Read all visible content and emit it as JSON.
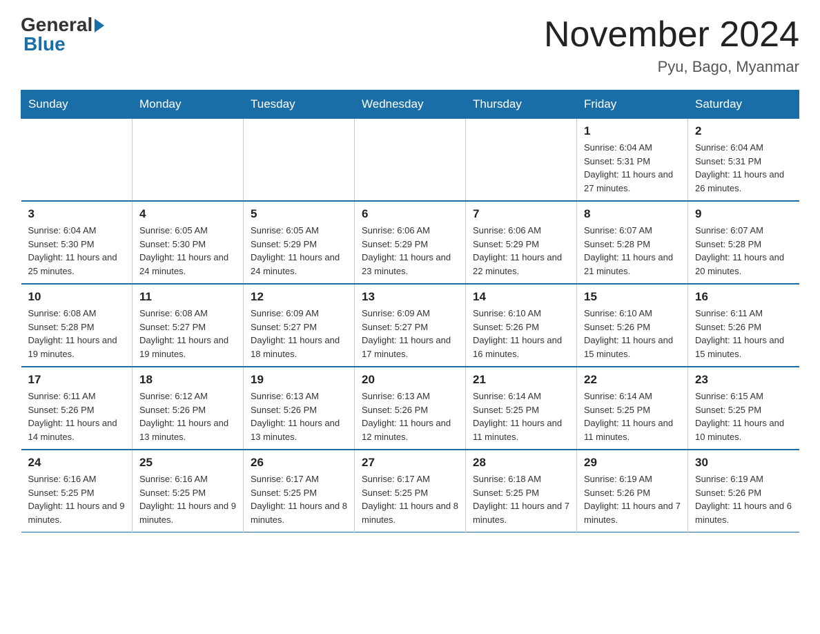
{
  "logo": {
    "general": "General",
    "blue": "Blue"
  },
  "header": {
    "month_year": "November 2024",
    "location": "Pyu, Bago, Myanmar"
  },
  "weekdays": [
    "Sunday",
    "Monday",
    "Tuesday",
    "Wednesday",
    "Thursday",
    "Friday",
    "Saturday"
  ],
  "weeks": [
    [
      {
        "day": "",
        "info": ""
      },
      {
        "day": "",
        "info": ""
      },
      {
        "day": "",
        "info": ""
      },
      {
        "day": "",
        "info": ""
      },
      {
        "day": "",
        "info": ""
      },
      {
        "day": "1",
        "info": "Sunrise: 6:04 AM\nSunset: 5:31 PM\nDaylight: 11 hours and 27 minutes."
      },
      {
        "day": "2",
        "info": "Sunrise: 6:04 AM\nSunset: 5:31 PM\nDaylight: 11 hours and 26 minutes."
      }
    ],
    [
      {
        "day": "3",
        "info": "Sunrise: 6:04 AM\nSunset: 5:30 PM\nDaylight: 11 hours and 25 minutes."
      },
      {
        "day": "4",
        "info": "Sunrise: 6:05 AM\nSunset: 5:30 PM\nDaylight: 11 hours and 24 minutes."
      },
      {
        "day": "5",
        "info": "Sunrise: 6:05 AM\nSunset: 5:29 PM\nDaylight: 11 hours and 24 minutes."
      },
      {
        "day": "6",
        "info": "Sunrise: 6:06 AM\nSunset: 5:29 PM\nDaylight: 11 hours and 23 minutes."
      },
      {
        "day": "7",
        "info": "Sunrise: 6:06 AM\nSunset: 5:29 PM\nDaylight: 11 hours and 22 minutes."
      },
      {
        "day": "8",
        "info": "Sunrise: 6:07 AM\nSunset: 5:28 PM\nDaylight: 11 hours and 21 minutes."
      },
      {
        "day": "9",
        "info": "Sunrise: 6:07 AM\nSunset: 5:28 PM\nDaylight: 11 hours and 20 minutes."
      }
    ],
    [
      {
        "day": "10",
        "info": "Sunrise: 6:08 AM\nSunset: 5:28 PM\nDaylight: 11 hours and 19 minutes."
      },
      {
        "day": "11",
        "info": "Sunrise: 6:08 AM\nSunset: 5:27 PM\nDaylight: 11 hours and 19 minutes."
      },
      {
        "day": "12",
        "info": "Sunrise: 6:09 AM\nSunset: 5:27 PM\nDaylight: 11 hours and 18 minutes."
      },
      {
        "day": "13",
        "info": "Sunrise: 6:09 AM\nSunset: 5:27 PM\nDaylight: 11 hours and 17 minutes."
      },
      {
        "day": "14",
        "info": "Sunrise: 6:10 AM\nSunset: 5:26 PM\nDaylight: 11 hours and 16 minutes."
      },
      {
        "day": "15",
        "info": "Sunrise: 6:10 AM\nSunset: 5:26 PM\nDaylight: 11 hours and 15 minutes."
      },
      {
        "day": "16",
        "info": "Sunrise: 6:11 AM\nSunset: 5:26 PM\nDaylight: 11 hours and 15 minutes."
      }
    ],
    [
      {
        "day": "17",
        "info": "Sunrise: 6:11 AM\nSunset: 5:26 PM\nDaylight: 11 hours and 14 minutes."
      },
      {
        "day": "18",
        "info": "Sunrise: 6:12 AM\nSunset: 5:26 PM\nDaylight: 11 hours and 13 minutes."
      },
      {
        "day": "19",
        "info": "Sunrise: 6:13 AM\nSunset: 5:26 PM\nDaylight: 11 hours and 13 minutes."
      },
      {
        "day": "20",
        "info": "Sunrise: 6:13 AM\nSunset: 5:26 PM\nDaylight: 11 hours and 12 minutes."
      },
      {
        "day": "21",
        "info": "Sunrise: 6:14 AM\nSunset: 5:25 PM\nDaylight: 11 hours and 11 minutes."
      },
      {
        "day": "22",
        "info": "Sunrise: 6:14 AM\nSunset: 5:25 PM\nDaylight: 11 hours and 11 minutes."
      },
      {
        "day": "23",
        "info": "Sunrise: 6:15 AM\nSunset: 5:25 PM\nDaylight: 11 hours and 10 minutes."
      }
    ],
    [
      {
        "day": "24",
        "info": "Sunrise: 6:16 AM\nSunset: 5:25 PM\nDaylight: 11 hours and 9 minutes."
      },
      {
        "day": "25",
        "info": "Sunrise: 6:16 AM\nSunset: 5:25 PM\nDaylight: 11 hours and 9 minutes."
      },
      {
        "day": "26",
        "info": "Sunrise: 6:17 AM\nSunset: 5:25 PM\nDaylight: 11 hours and 8 minutes."
      },
      {
        "day": "27",
        "info": "Sunrise: 6:17 AM\nSunset: 5:25 PM\nDaylight: 11 hours and 8 minutes."
      },
      {
        "day": "28",
        "info": "Sunrise: 6:18 AM\nSunset: 5:25 PM\nDaylight: 11 hours and 7 minutes."
      },
      {
        "day": "29",
        "info": "Sunrise: 6:19 AM\nSunset: 5:26 PM\nDaylight: 11 hours and 7 minutes."
      },
      {
        "day": "30",
        "info": "Sunrise: 6:19 AM\nSunset: 5:26 PM\nDaylight: 11 hours and 6 minutes."
      }
    ]
  ]
}
